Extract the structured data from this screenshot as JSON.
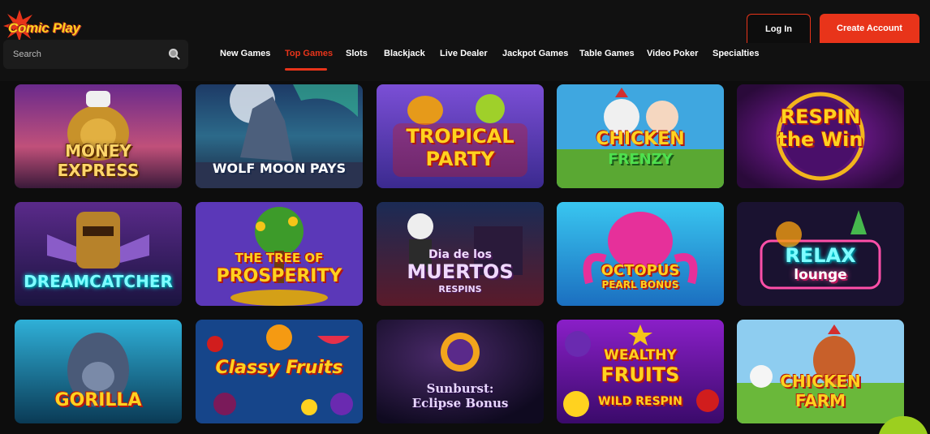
{
  "brand": {
    "name": "Comic Play"
  },
  "search": {
    "placeholder": "Search"
  },
  "nav": {
    "items": [
      {
        "label": "New Games",
        "active": false
      },
      {
        "label": "Top Games",
        "active": true
      },
      {
        "label": "Slots",
        "active": false
      },
      {
        "label": "Blackjack",
        "active": false
      },
      {
        "label": "Live Dealer",
        "active": false
      },
      {
        "label": "Jackpot Games",
        "active": false
      },
      {
        "label": "Table Games",
        "active": false
      },
      {
        "label": "Video Poker",
        "active": false
      },
      {
        "label": "Specialties",
        "active": false
      }
    ]
  },
  "auth": {
    "login_label": "Log In",
    "create_label": "Create Account"
  },
  "colors": {
    "accent": "#e8341a",
    "background": "#0d0d0d",
    "header": "#111111"
  },
  "games": [
    {
      "title_line1": "Money",
      "title_line2": "Express"
    },
    {
      "title_line1": "Wolf Moon Pays",
      "title_line2": ""
    },
    {
      "title_line1": "Tropical",
      "title_line2": "Party"
    },
    {
      "title_line1": "Chicken",
      "title_line2": "Frenzy"
    },
    {
      "title_line1": "Respin",
      "title_line2": "the Win"
    },
    {
      "title_line1": "Dreamcatcher",
      "title_line2": ""
    },
    {
      "title_line1": "The Tree of",
      "title_line2": "Prosperity"
    },
    {
      "title_line1": "Dia de los",
      "title_line2": "Muertos",
      "title_line3": "Respins"
    },
    {
      "title_line1": "Octopus",
      "title_line2": "Pearl Bonus"
    },
    {
      "title_line1": "Relax",
      "title_line2": "lounge"
    },
    {
      "title_line1": "Gorilla",
      "title_line2": ""
    },
    {
      "title_line1": "Classy Fruits",
      "title_line2": ""
    },
    {
      "title_line1": "Sunburst:",
      "title_line2": "Eclipse Bonus"
    },
    {
      "title_line1": "Wealthy",
      "title_line2": "Fruits",
      "title_line3": "Wild Respin"
    },
    {
      "title_line1": "Chicken",
      "title_line2": "Farm"
    }
  ]
}
